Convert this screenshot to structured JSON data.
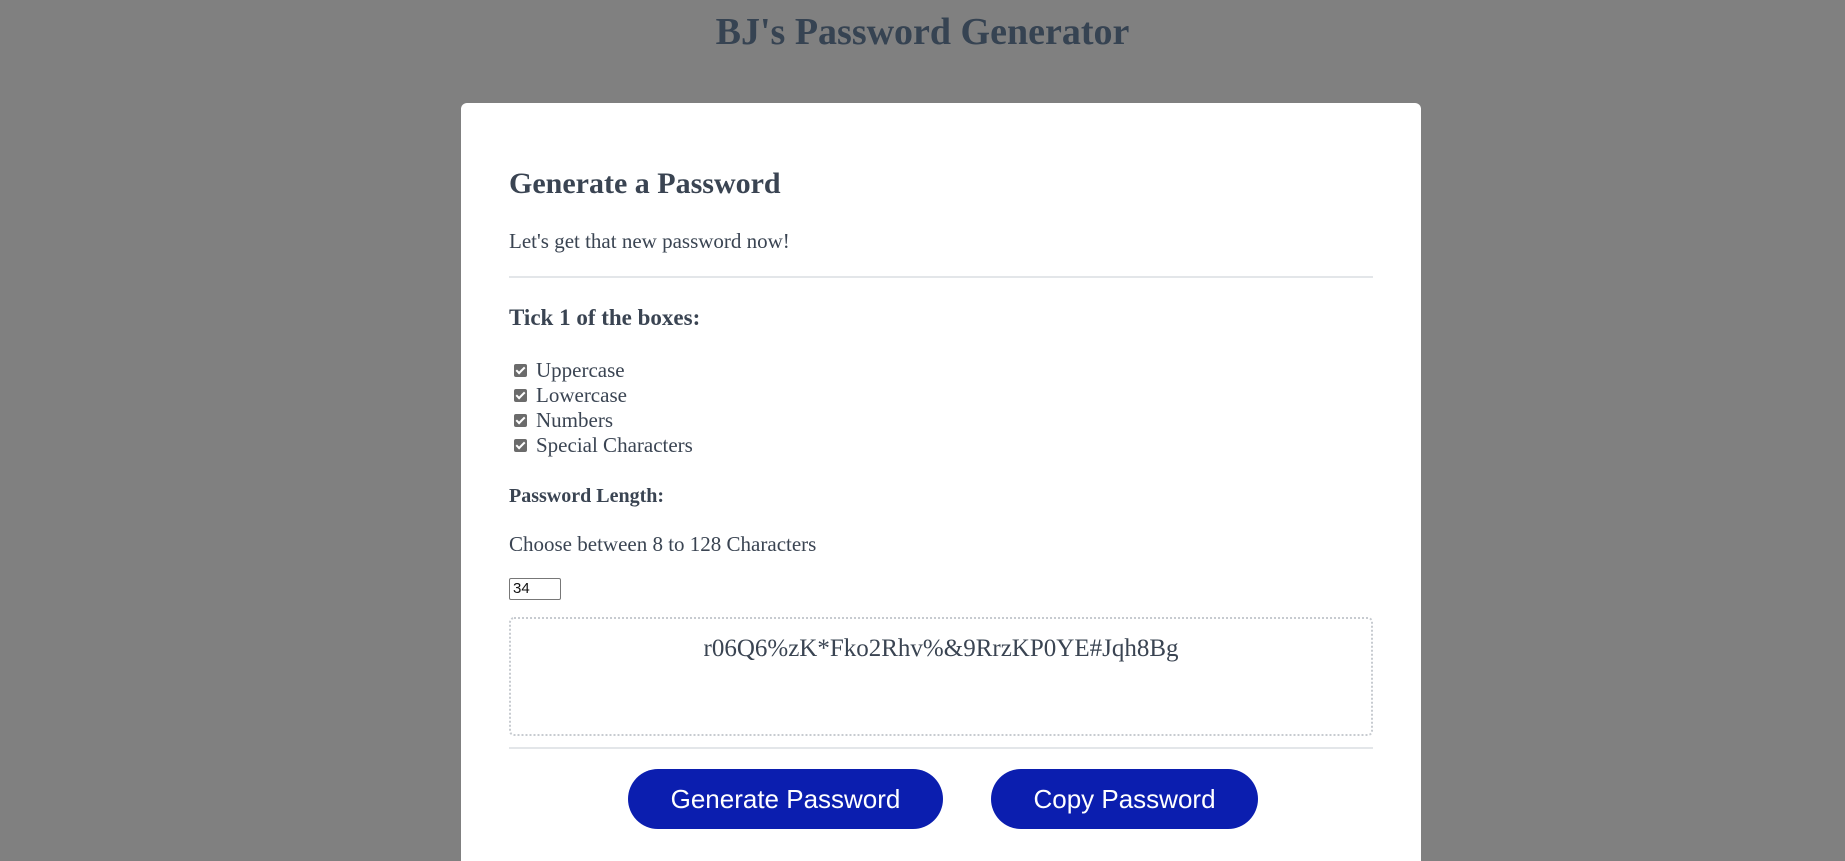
{
  "header": {
    "title": "BJ's Password Generator"
  },
  "card": {
    "title": "Generate a Password",
    "subtitle": "Let's get that new password now!",
    "options_title": "Tick 1 of the boxes:",
    "options": [
      {
        "label": "Uppercase",
        "checked": true
      },
      {
        "label": "Lowercase",
        "checked": true
      },
      {
        "label": "Numbers",
        "checked": true
      },
      {
        "label": "Special Characters",
        "checked": true
      }
    ],
    "length": {
      "label": "Password Length:",
      "help": "Choose between 8 to 128 Characters",
      "value": "34"
    },
    "password": "r06Q6%zK*Fko2Rhv%&9RrzKP0YE#Jqh8Bg",
    "buttons": {
      "generate": "Generate Password",
      "copy": "Copy Password"
    }
  },
  "colors": {
    "background": "#808080",
    "text": "#3a4452",
    "button": "#0b1eaf"
  }
}
